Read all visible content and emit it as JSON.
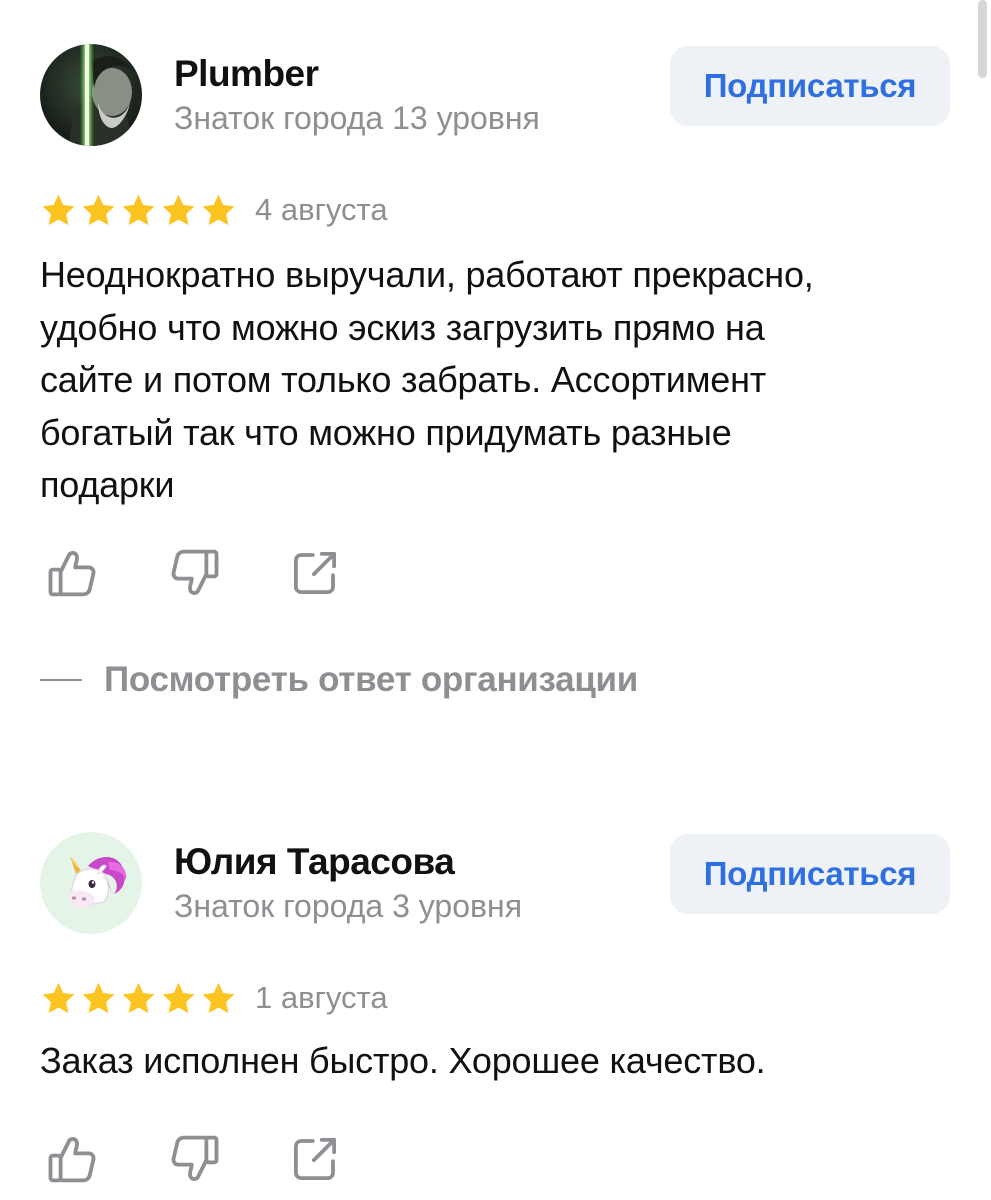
{
  "reviews": [
    {
      "author": "Plumber",
      "level": "Знаток города 13 уровня",
      "subscribe_label": "Подписаться",
      "rating": 5,
      "date": "4 августа",
      "text_lines": [
        "Неоднократно выручали, работают прекрасно,",
        "удобно что можно эскиз загрузить прямо на",
        "сайте и потом только забрать. Ассортимент",
        "богатый так что можно придумать разные",
        "подарки"
      ],
      "reply_link": "Посмотреть ответ организации"
    },
    {
      "author": "Юлия Тарасова",
      "level": "Знаток города 3 уровня",
      "subscribe_label": "Подписаться",
      "rating": 5,
      "date": "1 августа",
      "text_lines": [
        "Заказ исполнен быстро. Хорошее качество."
      ]
    }
  ],
  "icons": {
    "like": "thumbs-up-icon",
    "dislike": "thumbs-down-icon",
    "share": "share-icon",
    "star": "star-icon"
  },
  "colors": {
    "accent": "#2f6fe0",
    "star": "#fcc420",
    "muted": "#8e8e93",
    "button_bg": "#eef2f7"
  }
}
